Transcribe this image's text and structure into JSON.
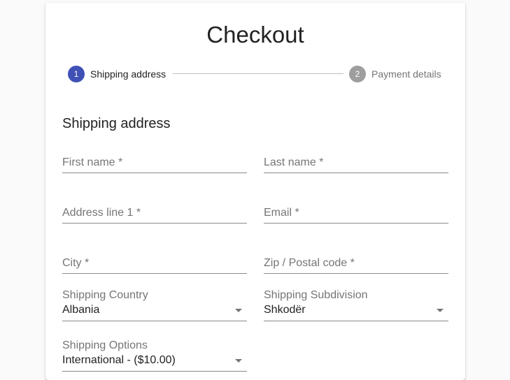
{
  "checkout": {
    "title": "Checkout",
    "stepper": {
      "steps": [
        {
          "number": "1",
          "label": "Shipping address",
          "state": "active"
        },
        {
          "number": "2",
          "label": "Payment details",
          "state": "inactive"
        }
      ]
    },
    "section_title": "Shipping address",
    "fields": {
      "first_name": {
        "placeholder": "First name *",
        "value": ""
      },
      "last_name": {
        "placeholder": "Last name *",
        "value": ""
      },
      "address_line1": {
        "placeholder": "Address line 1 *",
        "value": ""
      },
      "email": {
        "placeholder": "Email *",
        "value": ""
      },
      "city": {
        "placeholder": "City *",
        "value": ""
      },
      "zip": {
        "placeholder": "Zip / Postal code *",
        "value": ""
      },
      "shipping_country": {
        "label": "Shipping Country",
        "value": "Albania"
      },
      "shipping_subdivision": {
        "label": "Shipping Subdivision",
        "value": "Shkodër"
      },
      "shipping_options": {
        "label": "Shipping Options",
        "value": "International - ($10.00)"
      }
    }
  },
  "colors": {
    "accent": "#3f51b5",
    "inactive_step": "#9e9e9e",
    "background": "#fafafa",
    "card": "#ffffff"
  },
  "icons": {
    "select_arrow": "arrow-drop-down-icon"
  }
}
